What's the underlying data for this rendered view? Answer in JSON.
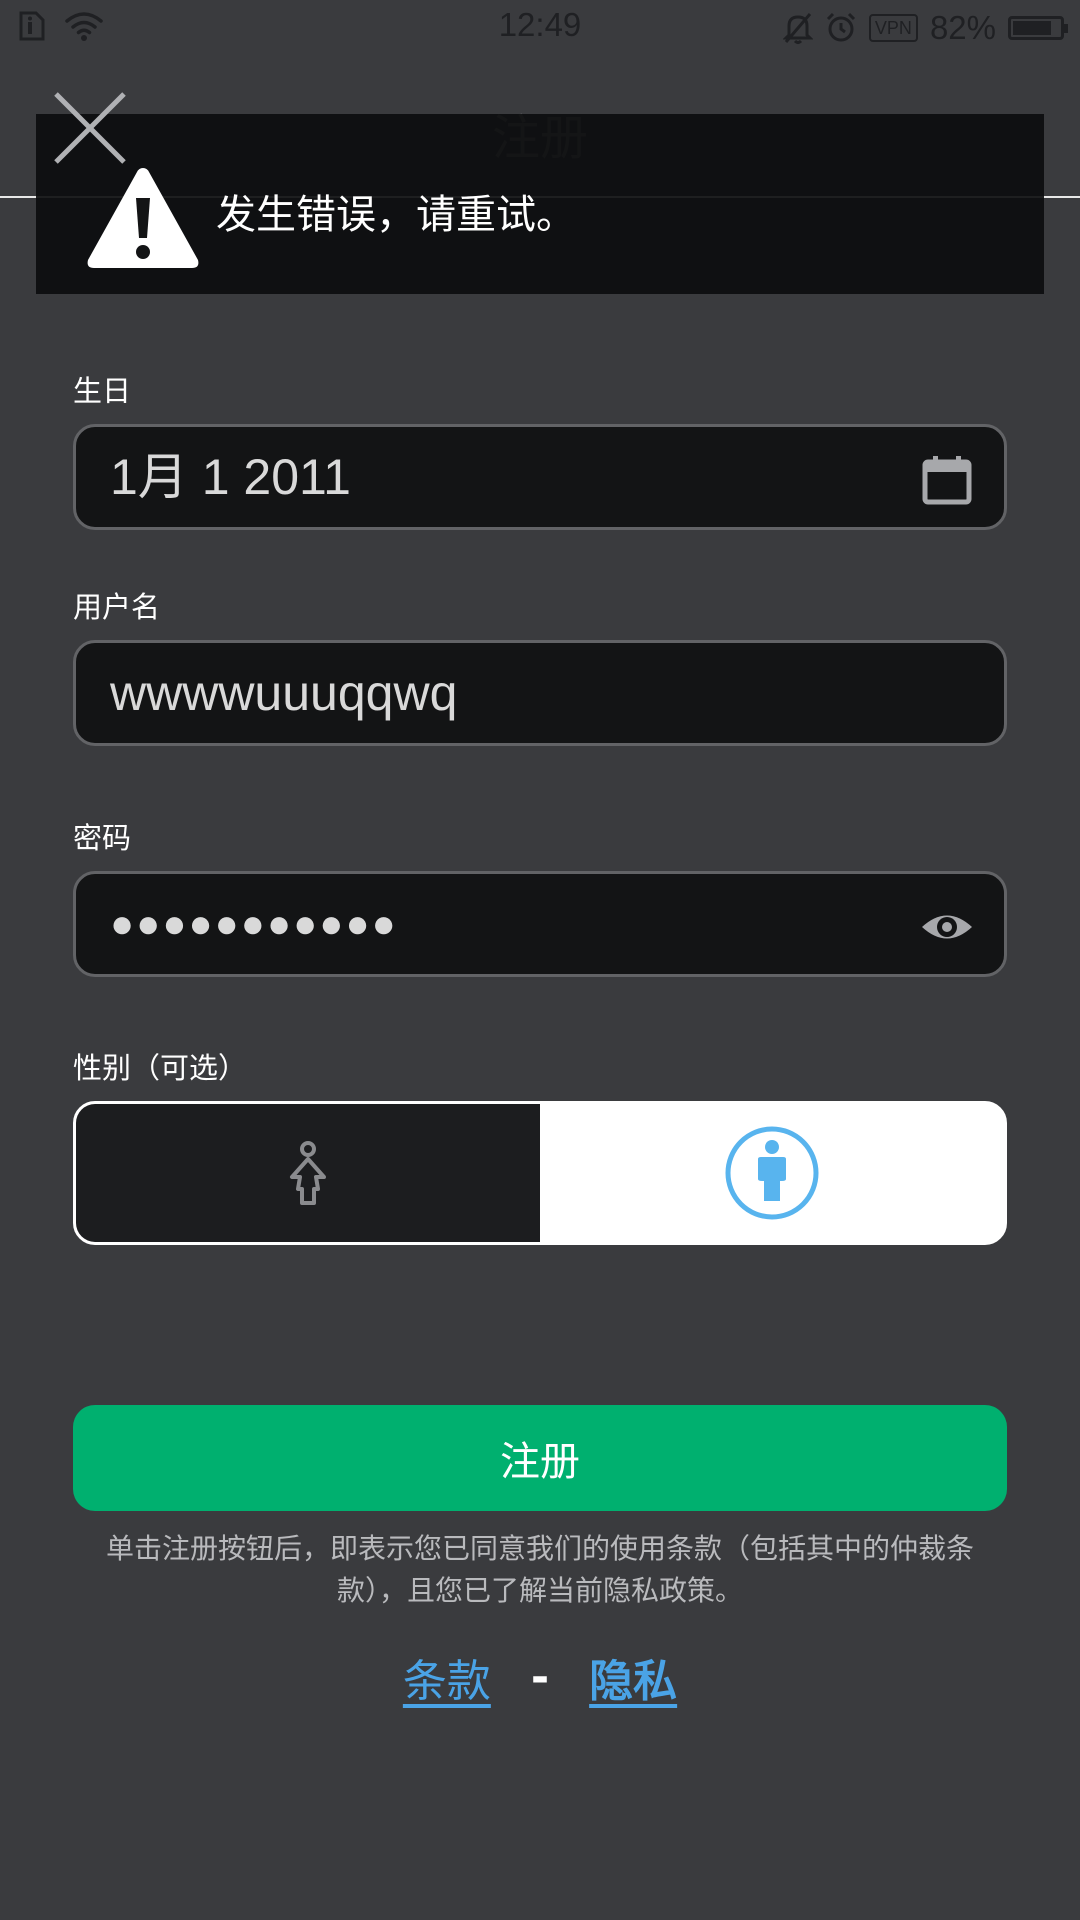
{
  "status_bar": {
    "time": "12:49",
    "battery_text": "82%",
    "battery_level": 0.82,
    "vpn_label": "VPN",
    "icons": [
      "sim-icon",
      "wifi-icon",
      "mute-icon",
      "alarm-icon",
      "vpn-icon",
      "battery-icon"
    ]
  },
  "header": {
    "title": "注册",
    "close_icon": "close-icon"
  },
  "error_toast": {
    "icon": "warning-icon",
    "message": "发生错误，请重试。"
  },
  "form": {
    "birthday": {
      "label": "生日",
      "value": "1月 1 2011",
      "icon": "calendar-icon"
    },
    "username": {
      "label": "用户名",
      "value": "wwwwuuuqqwq"
    },
    "password": {
      "label": "密码",
      "value": "●●●●●●●●●●●",
      "icon": "eye-icon"
    },
    "gender": {
      "label": "性别（可选）",
      "options": [
        {
          "name": "female",
          "icon": "female-icon",
          "selected": false
        },
        {
          "name": "male",
          "icon": "male-icon",
          "selected": true
        }
      ]
    }
  },
  "register_button": {
    "label": "注册"
  },
  "legal": {
    "text": "单击注册按钮后，即表示您已同意我们的使用条款（包括其中的仲裁条款），且您已了解当前隐私政策。",
    "terms_link": "条款",
    "separator": "-",
    "privacy_link": "隐私"
  },
  "colors": {
    "background": "#3a3b3e",
    "accent_green": "#00b06f",
    "link_blue": "#4aa3e6",
    "male_icon_blue": "#58b4ee"
  }
}
